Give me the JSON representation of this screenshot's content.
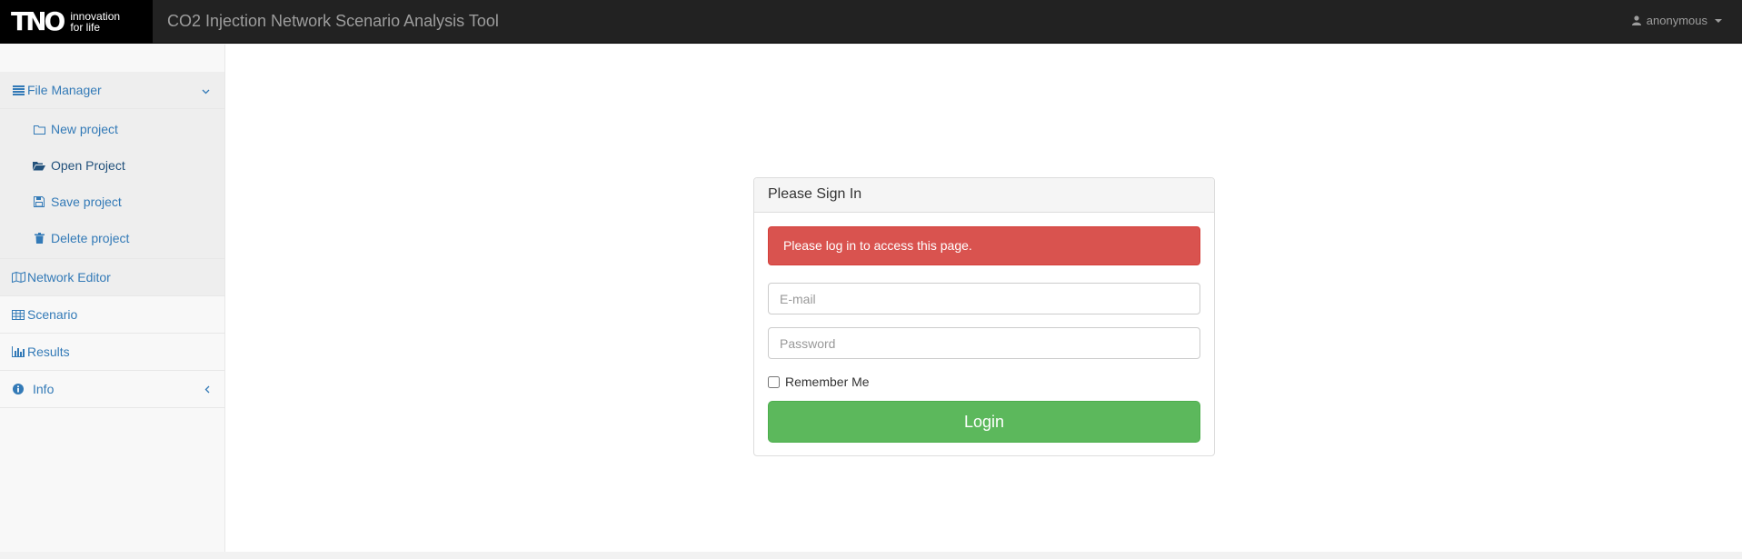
{
  "header": {
    "brand_logo": "TNO",
    "brand_tagline_1": "innovation",
    "brand_tagline_2": "for life",
    "app_title": "CO2 Injection Network Scenario Analysis Tool",
    "user_label": "anonymous"
  },
  "sidebar": {
    "file_manager": {
      "label": "File Manager",
      "icon": "list-icon",
      "expanded": true,
      "items": [
        {
          "label": "New project",
          "icon": "folder-icon"
        },
        {
          "label": "Open Project",
          "icon": "folder-open-icon"
        },
        {
          "label": "Save project",
          "icon": "floppy-icon"
        },
        {
          "label": "Delete project",
          "icon": "trash-icon"
        }
      ]
    },
    "items": [
      {
        "label": "Network Editor",
        "icon": "map-icon"
      },
      {
        "label": "Scenario",
        "icon": "table-icon"
      },
      {
        "label": "Results",
        "icon": "bar-chart-icon"
      },
      {
        "label": "Info",
        "icon": "info-circle-icon"
      }
    ]
  },
  "login": {
    "heading": "Please Sign In",
    "alert": "Please log in to access this page.",
    "email_placeholder": "E-mail",
    "password_placeholder": "Password",
    "remember_label": "Remember Me",
    "button_label": "Login"
  },
  "colors": {
    "navbar": "#222222",
    "link": "#337ab7",
    "danger": "#d9534f",
    "success": "#5cb85c"
  }
}
